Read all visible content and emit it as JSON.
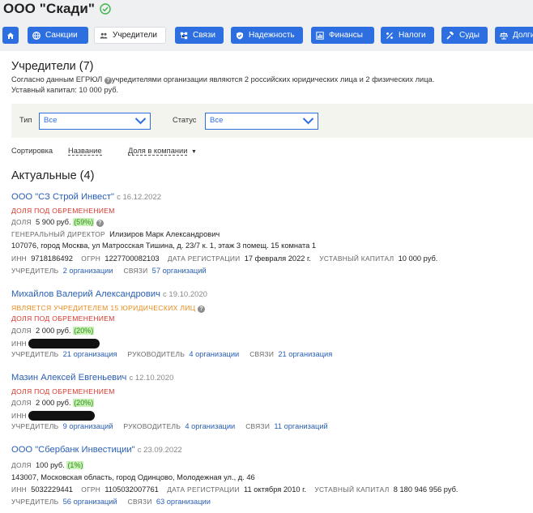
{
  "header": {
    "company_title": "ООО \"Скади\""
  },
  "tabs": [
    {
      "label": "",
      "icon": "home-icon"
    },
    {
      "label": "Санкции",
      "icon": "globe-icon"
    },
    {
      "label": "Учредители",
      "icon": "people-icon",
      "active": true
    },
    {
      "label": "Связи",
      "icon": "network-icon"
    },
    {
      "label": "Надежность",
      "icon": "shield-icon"
    },
    {
      "label": "Финансы",
      "icon": "chart-icon"
    },
    {
      "label": "Налоги",
      "icon": "percent-icon"
    },
    {
      "label": "Суды",
      "icon": "gavel-icon"
    },
    {
      "label": "Долги",
      "icon": "scales-icon"
    }
  ],
  "founders": {
    "title": "Учредители (7)",
    "desc_prefix": "Согласно данным ЕГРЮЛ",
    "desc_suffix": "учредителями организации являются 2 российских юридических лица и 2 физических лица.",
    "capital": "Уставный капитал: 10 000 руб."
  },
  "filters": {
    "type_label": "Тип",
    "type_value": "Все",
    "status_label": "Статус",
    "status_value": "Все"
  },
  "sort": {
    "label": "Сортировка",
    "by_name": "Название",
    "by_share": "Доля в компании"
  },
  "section": {
    "title": "Актуальные (4)"
  },
  "entries": [
    {
      "name": "ООО \"СЗ Строй Инвест\"",
      "since": "с 16.12.2022",
      "encumbrance": "ДОЛЯ ПОД ОБРЕМЕНЕНИЕМ",
      "share_label": "ДОЛЯ",
      "share_value": "5 900 руб.",
      "share_pct": "(59%)",
      "director_label": "ГЕНЕРАЛЬНЫЙ ДИРЕКТОР",
      "director_value": "Илизиров Марк Александрович",
      "address": "107076, город Москва, ул Матросская Тишина, д. 23/7 к. 1, этаж 3 помещ. 15 комната 1",
      "inn_label": "ИНН",
      "inn_value": "9718186492",
      "ogrn_label": "ОГРН",
      "ogrn_value": "1227700082103",
      "reg_label": "ДАТА РЕГИСТРАЦИИ",
      "reg_value": "17 февраля 2022 г.",
      "cap_label": "УСТАВНЫЙ КАПИТАЛ",
      "cap_value": "10 000 руб.",
      "founder_label": "УЧРЕДИТЕЛЬ",
      "founder_link": "2 организации",
      "links_label": "СВЯЗИ",
      "links_link": "57 организаций"
    },
    {
      "name": "Михайлов Валерий Александрович",
      "since": "с 19.10.2020",
      "founder_of": "ЯВЛЯЕТСЯ УЧРЕДИТЕЛЕМ 15 ЮРИДИЧЕСКИХ ЛИЦ",
      "encumbrance": "ДОЛЯ ПОД ОБРЕМЕНЕНИЕМ",
      "share_label": "ДОЛЯ",
      "share_value": "2 000 руб.",
      "share_pct": "(20%)",
      "inn_label": "ИНН",
      "founder_label": "УЧРЕДИТЕЛЬ",
      "founder_link": "21 организация",
      "manager_label": "РУКОВОДИТЕЛЬ",
      "manager_link": "4 организации",
      "links_label": "СВЯЗИ",
      "links_link": "21 организация"
    },
    {
      "name": "Мазин Алексей Евгеньевич",
      "since": "с 12.10.2020",
      "encumbrance": "ДОЛЯ ПОД ОБРЕМЕНЕНИЕМ",
      "share_label": "ДОЛЯ",
      "share_value": "2 000 руб.",
      "share_pct": "(20%)",
      "inn_label": "ИНН",
      "founder_label": "УЧРЕДИТЕЛЬ",
      "founder_link": "9 организаций",
      "manager_label": "РУКОВОДИТЕЛЬ",
      "manager_link": "4 организации",
      "links_label": "СВЯЗИ",
      "links_link": "11 организаций"
    },
    {
      "name": "ООО \"Сбербанк Инвестиции\"",
      "since": "с 23.09.2022",
      "share_label": "ДОЛЯ",
      "share_value": "100 руб.",
      "share_pct": "(1%)",
      "address": "143007, Московская область, город Одинцово, Молодежная ул., д. 46",
      "inn_label": "ИНН",
      "inn_value": "5032229441",
      "ogrn_label": "ОГРН",
      "ogrn_value": "1105032007761",
      "reg_label": "ДАТА РЕГИСТРАЦИИ",
      "reg_value": "11 октября 2010 г.",
      "cap_label": "УСТАВНЫЙ КАПИТАЛ",
      "cap_value": "8 180 946 956 руб.",
      "founder_label": "УЧРЕДИТЕЛЬ",
      "founder_link": "56 организаций",
      "links_label": "СВЯЗИ",
      "links_link": "63 организации"
    }
  ]
}
